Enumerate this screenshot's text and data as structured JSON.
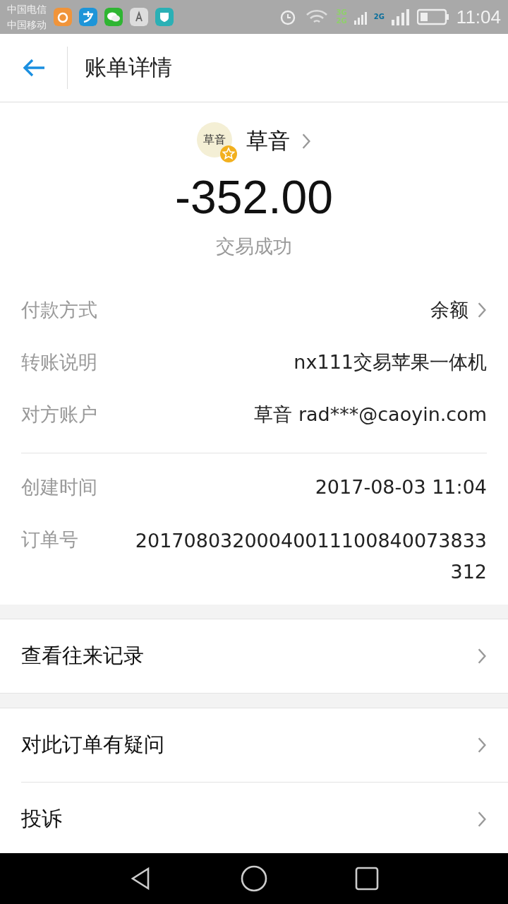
{
  "status_bar": {
    "carriers": [
      "中国电信",
      "中国移动"
    ],
    "network_labels": [
      "3G",
      "2G",
      "2G"
    ],
    "time": "11:04"
  },
  "header": {
    "title": "账单详情"
  },
  "payee": {
    "avatar_text": "草音",
    "name": "草音"
  },
  "amount": "-352.00",
  "status": "交易成功",
  "details": [
    {
      "label": "付款方式",
      "value": "余额",
      "link": true
    },
    {
      "label": "转账说明",
      "value": "nx111交易苹果一体机",
      "link": false
    },
    {
      "label": "对方账户",
      "value": "草音 rad***@caoyin.com",
      "link": false
    }
  ],
  "meta": [
    {
      "label": "创建时间",
      "value": "2017-08-03 11:04"
    },
    {
      "label": "订单号",
      "value": "20170803200040011100840073833312"
    }
  ],
  "action_groups": [
    [
      "查看往来记录"
    ],
    [
      "对此订单有疑问",
      "投诉"
    ]
  ]
}
